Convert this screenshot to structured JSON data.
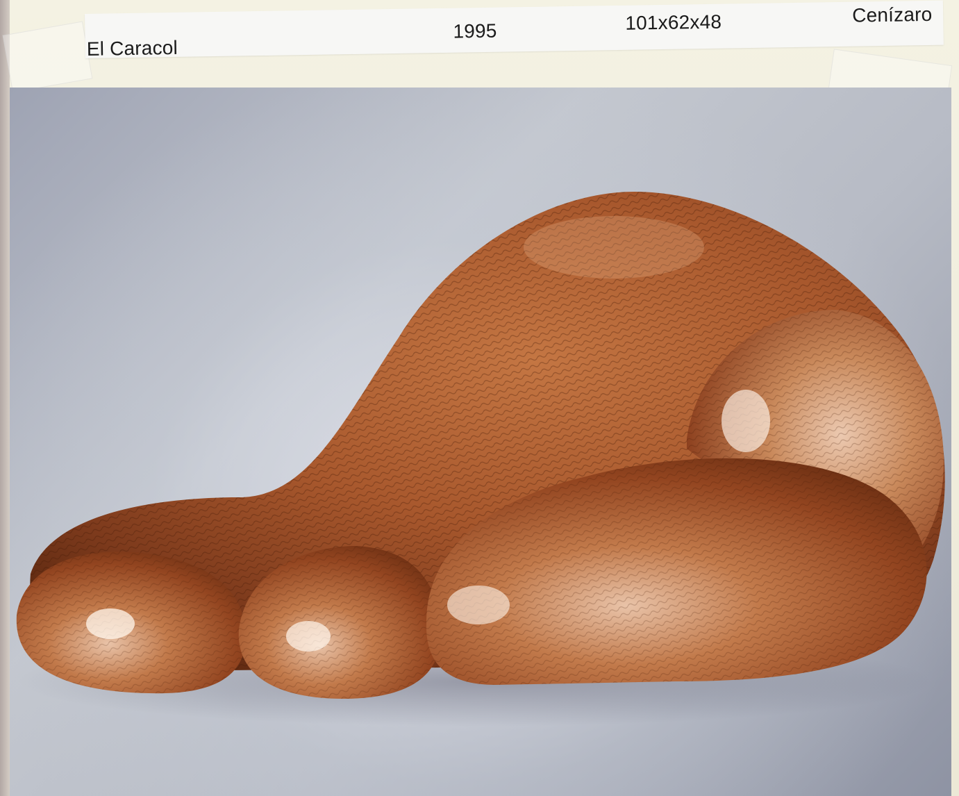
{
  "label": {
    "title": "El Caracol",
    "year": "1995",
    "dimensions": "101x62x48",
    "material": "Cenízaro"
  },
  "photo": {
    "subject": "wooden-snail-sculpture",
    "background_color": "#b4b8c3",
    "wood_color": "#a8582d"
  }
}
